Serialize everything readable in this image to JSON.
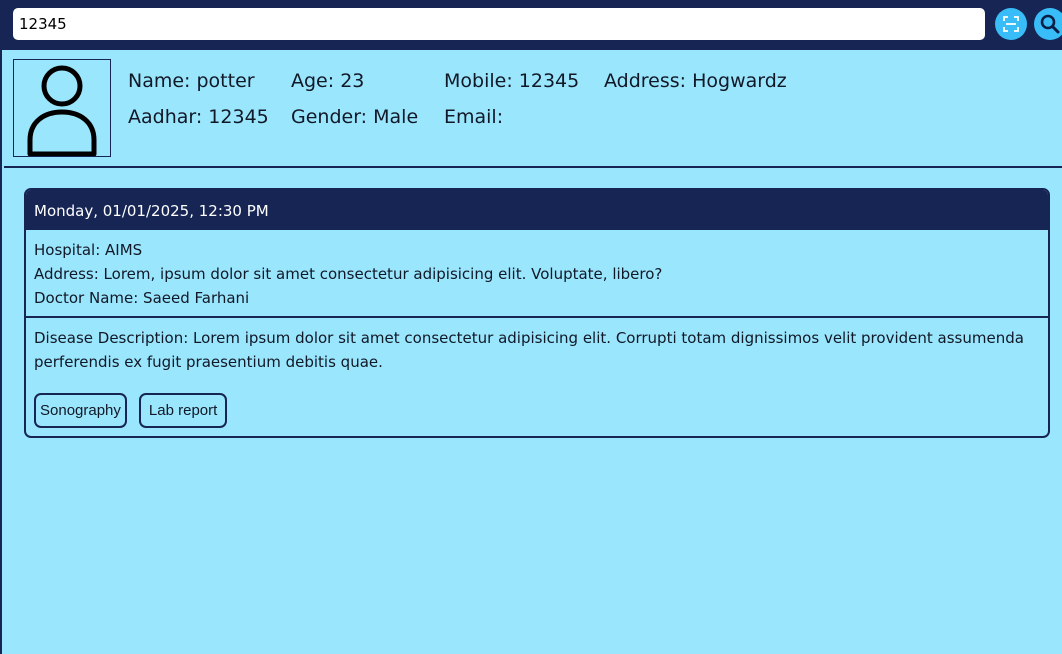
{
  "search": {
    "value": "12345",
    "placeholder": ""
  },
  "toolbar": {
    "scan_icon": "scan-icon",
    "search_icon": "search-icon",
    "accent_color": "#38bdf8",
    "bar_color": "#172554"
  },
  "patient": {
    "avatar_icon": "user-icon",
    "name": "Name: potter",
    "age": "Age: 23",
    "mobile": "Mobile: 12345",
    "address": "Address: Hogwardz",
    "aadhar": "Aadhar: 12345",
    "gender": "Gender: Male",
    "email": "Email:"
  },
  "visit": {
    "datetime": "Monday, 01/01/2025, 12:30 PM",
    "hospital": "Hospital: AIMS",
    "address": "Address: Lorem, ipsum dolor sit amet consectetur adipisicing elit. Voluptate, libero?",
    "doctor": "Doctor Name: Saeed Farhani",
    "description": "Disease Description: Lorem ipsum dolor sit amet consectetur adipisicing elit. Corrupti totam dignissimos velit provident assumenda perferendis ex fugit praesentium debitis quae.",
    "reports": [
      "Sonography",
      "Lab report"
    ]
  },
  "colors": {
    "background": "#9ae6fd",
    "dark": "#172554"
  }
}
